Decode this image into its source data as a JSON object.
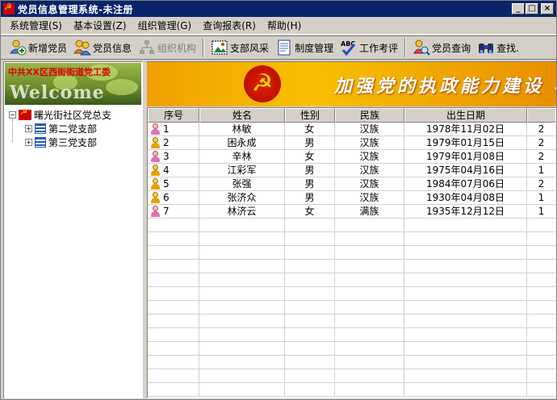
{
  "window": {
    "title": "党员信息管理系统-未注册",
    "controls": {
      "minimize": "_",
      "maximize": "□",
      "close": "×"
    }
  },
  "menu": [
    "系统管理(S)",
    "基本设置(Z)",
    "组织管理(G)",
    "查询报表(R)",
    "帮助(H)"
  ],
  "toolbar": {
    "buttons": [
      {
        "label": "新增党员",
        "icon": "add-member-icon",
        "disabled": false
      },
      {
        "label": "党员信息",
        "icon": "members-icon",
        "disabled": false
      },
      {
        "label": "组织机构",
        "icon": "org-chart-icon",
        "disabled": true
      },
      {
        "label": "支部风采",
        "icon": "picture-icon",
        "disabled": false
      },
      {
        "label": "制度管理",
        "icon": "document-icon",
        "disabled": false
      },
      {
        "label": "工作考评",
        "icon": "abc-check-icon",
        "disabled": false
      },
      {
        "label": "党员查询",
        "icon": "member-search-icon",
        "disabled": false
      },
      {
        "label": "查找.",
        "icon": "binoculars-icon",
        "disabled": false
      }
    ]
  },
  "left_banner": {
    "org_name": "中共XX区西街街道党工委",
    "welcome": "Welcome"
  },
  "tree": {
    "root": "曙光街社区党总支",
    "children": [
      "第二党支部",
      "第三党支部"
    ]
  },
  "right_banner": {
    "slogan": "加强党的执政能力建设 与"
  },
  "grid": {
    "columns": [
      "序号",
      "姓名",
      "性别",
      "民族",
      "出生日期",
      ""
    ],
    "rows": [
      {
        "seq": "1",
        "name": "林敏",
        "gender": "女",
        "ethnicity": "汉族",
        "birth": "1978年11月02日",
        "extra": "2"
      },
      {
        "seq": "2",
        "name": "困永成",
        "gender": "男",
        "ethnicity": "汉族",
        "birth": "1979年01月15日",
        "extra": "2"
      },
      {
        "seq": "3",
        "name": "辛林",
        "gender": "女",
        "ethnicity": "汉族",
        "birth": "1979年01月08日",
        "extra": "2"
      },
      {
        "seq": "4",
        "name": "江彩军",
        "gender": "男",
        "ethnicity": "汉族",
        "birth": "1975年04月16日",
        "extra": "1"
      },
      {
        "seq": "5",
        "name": "张强",
        "gender": "男",
        "ethnicity": "汉族",
        "birth": "1984年07月06日",
        "extra": "2"
      },
      {
        "seq": "6",
        "name": "张济众",
        "gender": "男",
        "ethnicity": "汉族",
        "birth": "1930年04月08日",
        "extra": "1"
      },
      {
        "seq": "7",
        "name": "林济云",
        "gender": "女",
        "ethnicity": "满族",
        "birth": "1935年12月12日",
        "extra": "1"
      }
    ]
  },
  "colors": {
    "titlebar": "#0a246a",
    "chrome": "#d4d0c8",
    "banner_orange": "#f8c000",
    "party_red": "#d00000"
  }
}
